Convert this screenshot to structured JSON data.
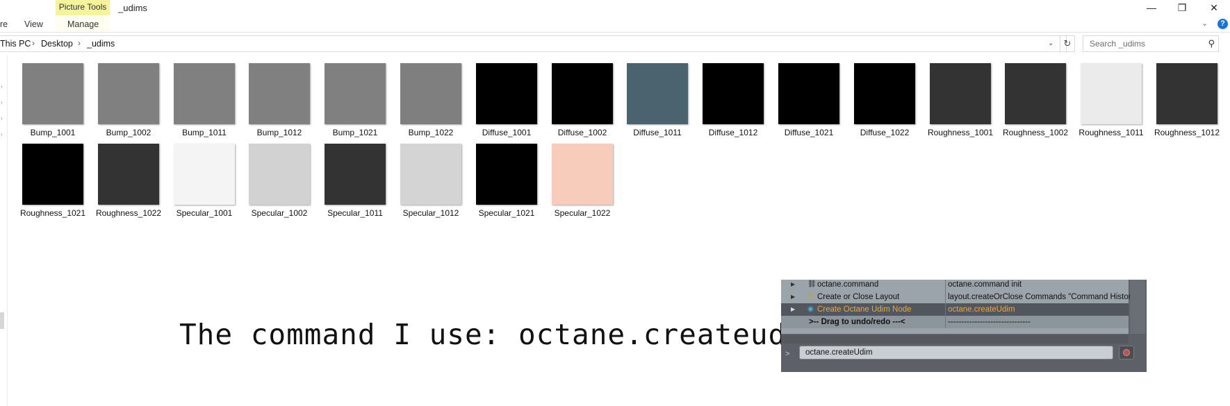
{
  "ribbon": {
    "tabs": [
      "re",
      "View",
      "Manage"
    ],
    "context_group": "Picture Tools",
    "window_title": "_udims",
    "minimize_glyph": "—",
    "maximize_glyph": "❐",
    "close_glyph": "✕",
    "help_glyph": "?"
  },
  "address": {
    "crumbs": [
      "This PC",
      "Desktop",
      "_udims"
    ],
    "separator": "›"
  },
  "search": {
    "placeholder": "Search _udims"
  },
  "files": [
    {
      "name": "Bump_1001",
      "color": "#808080"
    },
    {
      "name": "Bump_1002",
      "color": "#808080"
    },
    {
      "name": "Bump_1011",
      "color": "#808080"
    },
    {
      "name": "Bump_1012",
      "color": "#808080"
    },
    {
      "name": "Bump_1021",
      "color": "#808080"
    },
    {
      "name": "Bump_1022",
      "color": "#7f7f7f"
    },
    {
      "name": "Diffuse_1001",
      "color": "#000000"
    },
    {
      "name": "Diffuse_1002",
      "color": "#000000"
    },
    {
      "name": "Diffuse_1011",
      "color": "#4a636f"
    },
    {
      "name": "Diffuse_1012",
      "color": "#000000"
    },
    {
      "name": "Diffuse_1021",
      "color": "#000000"
    },
    {
      "name": "Diffuse_1022",
      "color": "#000000"
    },
    {
      "name": "Roughness_1001",
      "color": "#333333"
    },
    {
      "name": "Roughness_1002",
      "color": "#333333"
    },
    {
      "name": "Roughness_1011",
      "color": "#ebebeb"
    },
    {
      "name": "Roughness_1012",
      "color": "#333333"
    },
    {
      "name": "Roughness_1021",
      "color": "#000000"
    },
    {
      "name": "Roughness_1022",
      "color": "#333333"
    },
    {
      "name": "Specular_1001",
      "color": "#f4f4f4"
    },
    {
      "name": "Specular_1002",
      "color": "#d2d2d2"
    },
    {
      "name": "Specular_1011",
      "color": "#333333"
    },
    {
      "name": "Specular_1012",
      "color": "#d4d4d4"
    },
    {
      "name": "Specular_1021",
      "color": "#000000"
    },
    {
      "name": "Specular_1022",
      "color": "#f8ccbb"
    }
  ],
  "caption": "The command I use: octane.createudim",
  "command_panel": {
    "rows": [
      {
        "name": "octane.command",
        "command": "octane.command init",
        "icon": "link-icon",
        "selected": false
      },
      {
        "name": "Create or Close Layout",
        "command": "layout.createOrClose Commands \"Command History\"",
        "icon": "pencil-icon",
        "selected": false
      },
      {
        "name": "Create Octane Udim Node",
        "command": "octane.createUdim",
        "icon": "octane-icon",
        "selected": true
      }
    ],
    "drag_label": ">-- Drag to undo/redo ---<",
    "drag_dashes": "-------------------------------",
    "prompt": ">",
    "input_value": "octane.createUdim"
  }
}
